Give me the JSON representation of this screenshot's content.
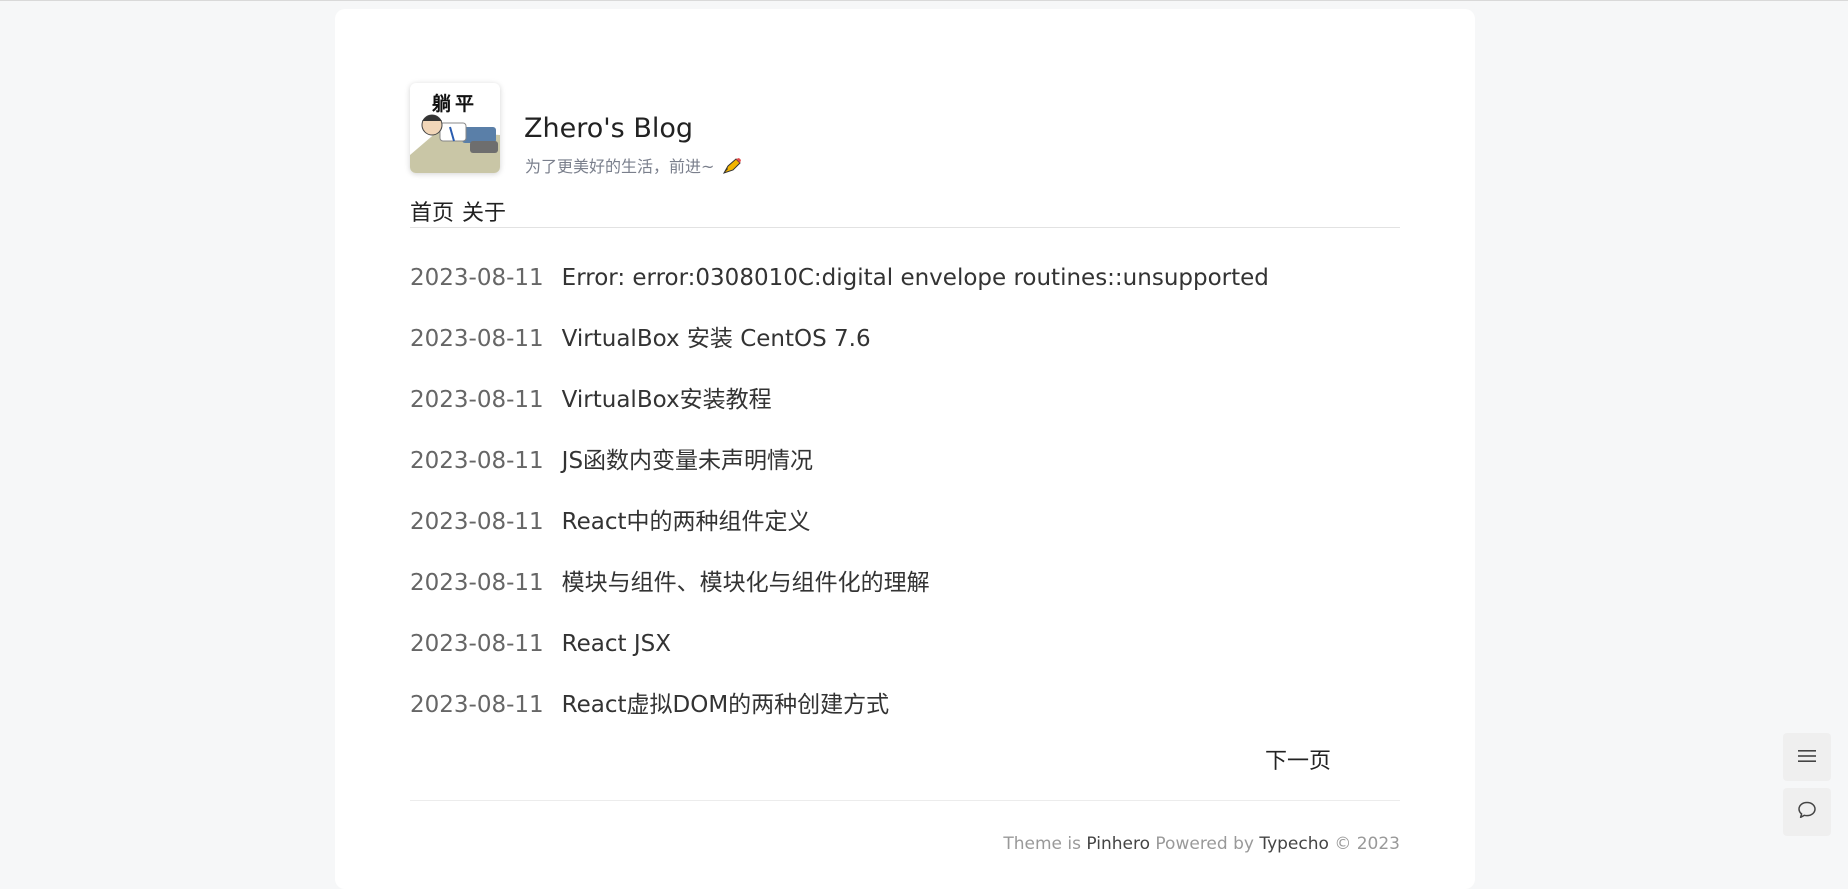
{
  "site": {
    "avatar_text": "躺平",
    "title": "Zhero's Blog",
    "description": "为了更美好的生活，前进~"
  },
  "nav": {
    "home": "首页",
    "about": "关于"
  },
  "posts": [
    {
      "date": "2023-08-11",
      "title": "Error: error:0308010C:digital envelope routines::unsupported"
    },
    {
      "date": "2023-08-11",
      "title": "VirtualBox 安装 CentOS 7.6"
    },
    {
      "date": "2023-08-11",
      "title": "VirtualBox安装教程"
    },
    {
      "date": "2023-08-11",
      "title": "JS函数内变量未声明情况"
    },
    {
      "date": "2023-08-11",
      "title": "React中的两种组件定义"
    },
    {
      "date": "2023-08-11",
      "title": "模块与组件、模块化与组件化的理解"
    },
    {
      "date": "2023-08-11",
      "title": "React JSX"
    },
    {
      "date": "2023-08-11",
      "title": "React虚拟DOM的两种创建方式"
    }
  ],
  "pagination": {
    "next": "下一页"
  },
  "footer": {
    "theme_prefix": "Theme is ",
    "theme_name": "Pinhero",
    "powered_prefix": " Powered by ",
    "powered_name": "Typecho",
    "copyright": " © 2023"
  },
  "icons": {
    "menu": "menu-icon",
    "comment": "comment-icon",
    "pencil": "pencil-icon"
  }
}
